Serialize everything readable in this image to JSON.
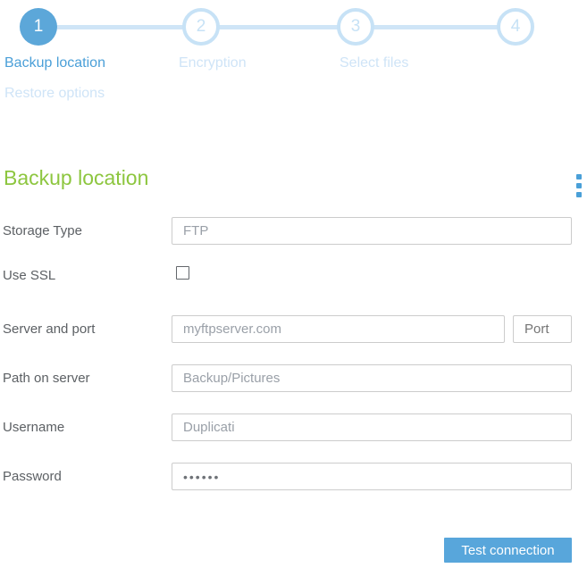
{
  "wizard": {
    "steps": [
      {
        "number": "1",
        "label": "Backup location",
        "state": "active"
      },
      {
        "number": "2",
        "label": "Encryption",
        "state": "inactive"
      },
      {
        "number": "3",
        "label": "Select files",
        "state": "inactive"
      },
      {
        "number": "4",
        "label": "Restore options",
        "state": "inactive"
      }
    ]
  },
  "section": {
    "title": "Backup location"
  },
  "form": {
    "storage_type": {
      "label": "Storage Type",
      "value": "FTP"
    },
    "use_ssl": {
      "label": "Use SSL",
      "checked": false
    },
    "server_and_port": {
      "label": "Server and port",
      "server_value": "myftpserver.com",
      "port_placeholder": "Port"
    },
    "path_on_server": {
      "label": "Path on server",
      "value": "Backup/Pictures"
    },
    "username": {
      "label": "Username",
      "value": "Duplicati"
    },
    "password": {
      "label": "Password",
      "masked_value": "••••••"
    }
  },
  "actions": {
    "test_connection_label": "Test connection"
  },
  "colors": {
    "accent_blue": "#4aa0d8",
    "active_circle_blue": "#5ca7d9",
    "inactive_light_blue": "#c7e2f6",
    "heading_green": "#8dc63f",
    "button_blue": "#58a6db"
  }
}
